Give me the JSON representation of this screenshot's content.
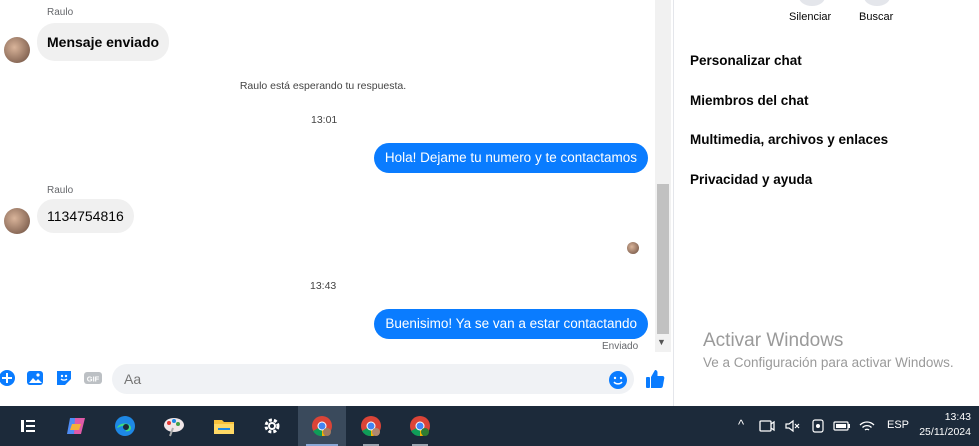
{
  "chat": {
    "messages": {
      "m1_sender": "Raulo",
      "m1_text": "Mensaje enviado",
      "system_text": "Raulo está esperando tu respuesta.",
      "time1": "13:01",
      "m2_text": "Hola! Dejame tu numero y te contactamos",
      "m3_sender": "Raulo",
      "m3_text": "1134754816",
      "time2": "13:43",
      "m4_text": "Buenisimo! Ya se van a estar contactando",
      "m4_status": "Enviado"
    },
    "composer": {
      "placeholder": "Aa"
    }
  },
  "right_panel": {
    "actions": {
      "mute": "Silenciar",
      "search": "Buscar"
    },
    "menu": {
      "customize": "Personalizar chat",
      "members": "Miembros del chat",
      "media": "Multimedia, archivos y enlaces",
      "privacy": "Privacidad y ayuda"
    },
    "activate_title": "Activar Windows",
    "activate_sub": "Ve a Configuración para activar Windows."
  },
  "taskbar": {
    "language": "ESP",
    "time": "13:43",
    "date": "25/11/2024"
  },
  "colors": {
    "accent": "#0a7cff",
    "taskbar": "#1c2a3a"
  }
}
